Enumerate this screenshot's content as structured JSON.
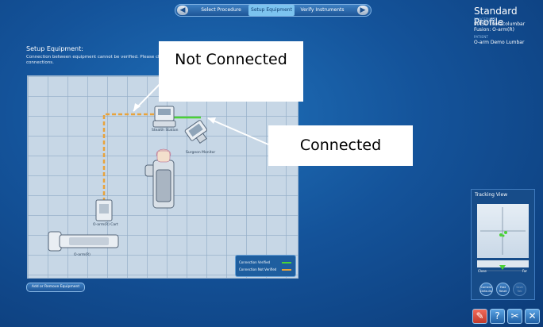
{
  "nav": {
    "prev_icon": "left-arrow-icon",
    "tabs": [
      {
        "label": "Select Procedure"
      },
      {
        "label": "Setup Equipment"
      },
      {
        "label": "Verify Instruments"
      }
    ],
    "next_icon": "right-arrow-icon"
  },
  "profile": {
    "title": "Standard Profile",
    "procedure_caption": "PROCEDURE",
    "procedure_line1": "MAST Thoracolumbar",
    "procedure_line2": "Fusion: O-arm(R)",
    "patient_caption": "PATIENT",
    "patient": "O-arm Demo Lumbar"
  },
  "setup": {
    "title": "Setup Equipment:",
    "message": "Connection between equipment cannot be verified. Please check connections."
  },
  "equipment": {
    "stealth_station": "Stealth Station",
    "surgeon_monitor": "Surgeon Monitor",
    "oarm_cart": "O-arm(R) Cart",
    "oarm": "O-arm(R)"
  },
  "callouts": {
    "not_connected": "Not Connected",
    "connected": "Connected"
  },
  "legend": {
    "verified": "Connection Verified",
    "not_verified": "Connection Not Verified",
    "verified_color": "#4cd137",
    "not_verified_color": "#e8a33c"
  },
  "add_remove_label": "Add or Remove Equipment",
  "tracking": {
    "title": "Tracking View",
    "close": "Close",
    "far": "Far",
    "camera_defaults": "Camera Defaults",
    "fast_reset": "Fast Reset",
    "save_tab": "Save Tab"
  },
  "toolbar": {
    "icons": [
      "navigation-icon",
      "help-icon",
      "wrench-icon",
      "close-icon"
    ]
  }
}
